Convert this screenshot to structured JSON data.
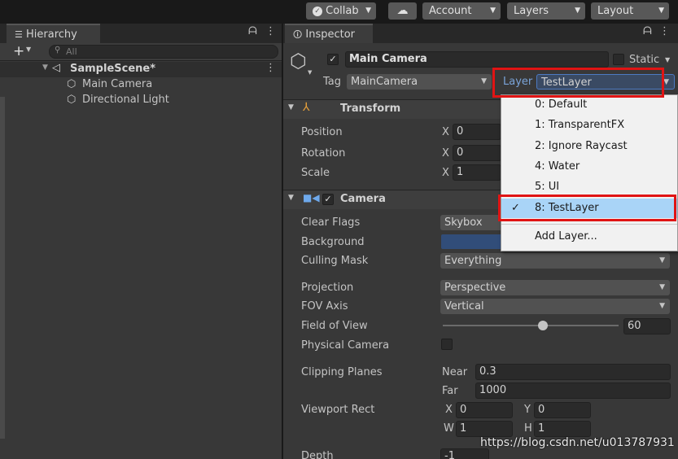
{
  "toolbar": {
    "collab": "Collab",
    "account": "Account",
    "layers": "Layers",
    "layout": "Layout"
  },
  "hierarchy": {
    "tab": "Hierarchy",
    "search_placeholder": "All",
    "scene": "SampleScene*",
    "items": [
      "Main Camera",
      "Directional Light"
    ]
  },
  "inspector": {
    "tab": "Inspector",
    "object_name": "Main Camera",
    "static_label": "Static",
    "tag_label": "Tag",
    "tag_value": "MainCamera",
    "layer_label": "Layer",
    "layer_value": "TestLayer",
    "transform": {
      "title": "Transform",
      "rows": [
        {
          "label": "Position",
          "x": "0"
        },
        {
          "label": "Rotation",
          "x": "0"
        },
        {
          "label": "Scale",
          "x": "1"
        }
      ]
    },
    "camera": {
      "title": "Camera",
      "clear_flags": {
        "label": "Clear Flags",
        "value": "Skybox"
      },
      "background": {
        "label": "Background",
        "color": "#314d79"
      },
      "culling_mask": {
        "label": "Culling Mask",
        "value": "Everything"
      },
      "projection": {
        "label": "Projection",
        "value": "Perspective"
      },
      "fov_axis": {
        "label": "FOV Axis",
        "value": "Vertical"
      },
      "fov": {
        "label": "Field of View",
        "value": "60",
        "fraction": 0.57
      },
      "physical": {
        "label": "Physical Camera"
      },
      "clipping": {
        "label": "Clipping Planes",
        "near_label": "Near",
        "near": "0.3",
        "far_label": "Far",
        "far": "1000"
      },
      "viewport": {
        "label": "Viewport Rect",
        "x": "0",
        "y": "0",
        "w": "1",
        "h": "1"
      },
      "depth": {
        "label": "Depth",
        "value": "-1"
      }
    }
  },
  "layer_menu": {
    "items": [
      "0: Default",
      "1: TransparentFX",
      "2: Ignore Raycast",
      "4: Water",
      "5: UI",
      "8: TestLayer"
    ],
    "add": "Add Layer...",
    "selected": "8: TestLayer"
  },
  "watermark": "https://blog.csdn.net/u013787931",
  "colors": {
    "accent_red": "#e01414",
    "menu_highlight": "#a9d4f7",
    "panel_bg": "#383838"
  }
}
